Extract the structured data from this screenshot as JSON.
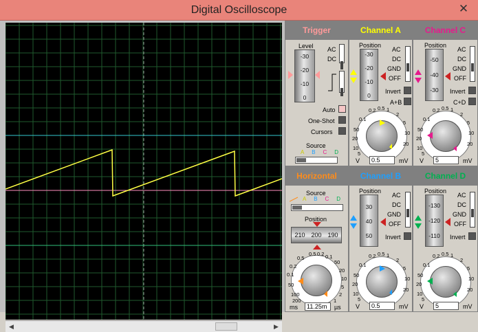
{
  "window": {
    "title": "Digital Oscilloscope",
    "close": "✕"
  },
  "trigger": {
    "title": "Trigger",
    "level_label": "Level",
    "level_ticks": [
      "-30",
      "-20",
      "-10",
      "0"
    ],
    "ac": "AC",
    "dc": "DC",
    "auto": "Auto",
    "one_shot": "One-Shot",
    "cursors": "Cursors",
    "source_label": "Source",
    "sources": [
      "A",
      "B",
      "C",
      "D"
    ]
  },
  "horizontal": {
    "title": "Horizontal",
    "source_label": "Source",
    "sources": [
      "A",
      "B",
      "C",
      "D"
    ],
    "position_label": "Position",
    "position_ticks": [
      "210",
      "200",
      "190"
    ],
    "dial_ticks": [
      "0.5",
      "0.2",
      "0.1",
      "50",
      "20",
      "10",
      "5",
      "2",
      "1",
      "0.5",
      "0.2",
      "0.1",
      "50",
      "100",
      "200"
    ],
    "value": "11.25m",
    "unit_left": "ms",
    "unit_right": "µs"
  },
  "channels": {
    "a": {
      "title": "Channel A",
      "position_label": "Position",
      "position_ticks": [
        "-30",
        "-20",
        "-10",
        "0"
      ],
      "modes": [
        "AC",
        "DC",
        "GND",
        "OFF"
      ],
      "invert": "Invert",
      "combine": "A+B",
      "dial_ticks": [
        "0.2",
        "0.5",
        "1",
        "2",
        "5",
        "10",
        "20",
        "0.1",
        "50",
        "20",
        "10",
        "5",
        "2"
      ],
      "value": "0.5",
      "unit_left": "V",
      "unit_right": "mV",
      "color": "#ffff00"
    },
    "b": {
      "title": "Channel B",
      "position_label": "Position",
      "position_ticks": [
        "30",
        "40",
        "50"
      ],
      "modes": [
        "AC",
        "DC",
        "GND",
        "OFF"
      ],
      "invert": "Invert",
      "dial_ticks": [
        "0.2",
        "0.5",
        "1",
        "2",
        "5",
        "10",
        "20",
        "0.1",
        "50",
        "20",
        "10",
        "5",
        "2"
      ],
      "value": "0.5",
      "unit_left": "V",
      "unit_right": "mV",
      "color": "#1e9fff"
    },
    "c": {
      "title": "Channel C",
      "position_label": "Position",
      "position_ticks": [
        "-50",
        "-40",
        "-30"
      ],
      "modes": [
        "AC",
        "DC",
        "GND",
        "OFF"
      ],
      "invert": "Invert",
      "combine": "C+D",
      "dial_ticks": [
        "0.2",
        "0.5",
        "1",
        "2",
        "5",
        "10",
        "20",
        "0.1",
        "50",
        "20",
        "10",
        "5",
        "2"
      ],
      "value": "5",
      "unit_left": "V",
      "unit_right": "mV",
      "color": "#e61a8d"
    },
    "d": {
      "title": "Channel D",
      "position_label": "Position",
      "position_ticks": [
        "-130",
        "-120",
        "-110"
      ],
      "modes": [
        "AC",
        "DC",
        "GND",
        "OFF"
      ],
      "invert": "Invert",
      "dial_ticks": [
        "0.2",
        "0.5",
        "1",
        "2",
        "5",
        "10",
        "20",
        "0.1",
        "50",
        "20",
        "10",
        "5",
        "2"
      ],
      "value": "5",
      "unit_left": "V",
      "unit_right": "mV",
      "color": "#00b050"
    }
  },
  "colors": {
    "trigger": "#ff9a9a",
    "horizontal": "#ff8c1a",
    "ch_a": "#ffff00",
    "ch_b": "#1e9fff",
    "ch_c": "#e61a8d",
    "ch_d": "#00b050",
    "trace_a": "#ffff44",
    "trace_c": "#ff8fbf",
    "trace_b": "#35c8d0",
    "trace_d": "#2fbf7a",
    "grid": "#1f5a2e"
  }
}
